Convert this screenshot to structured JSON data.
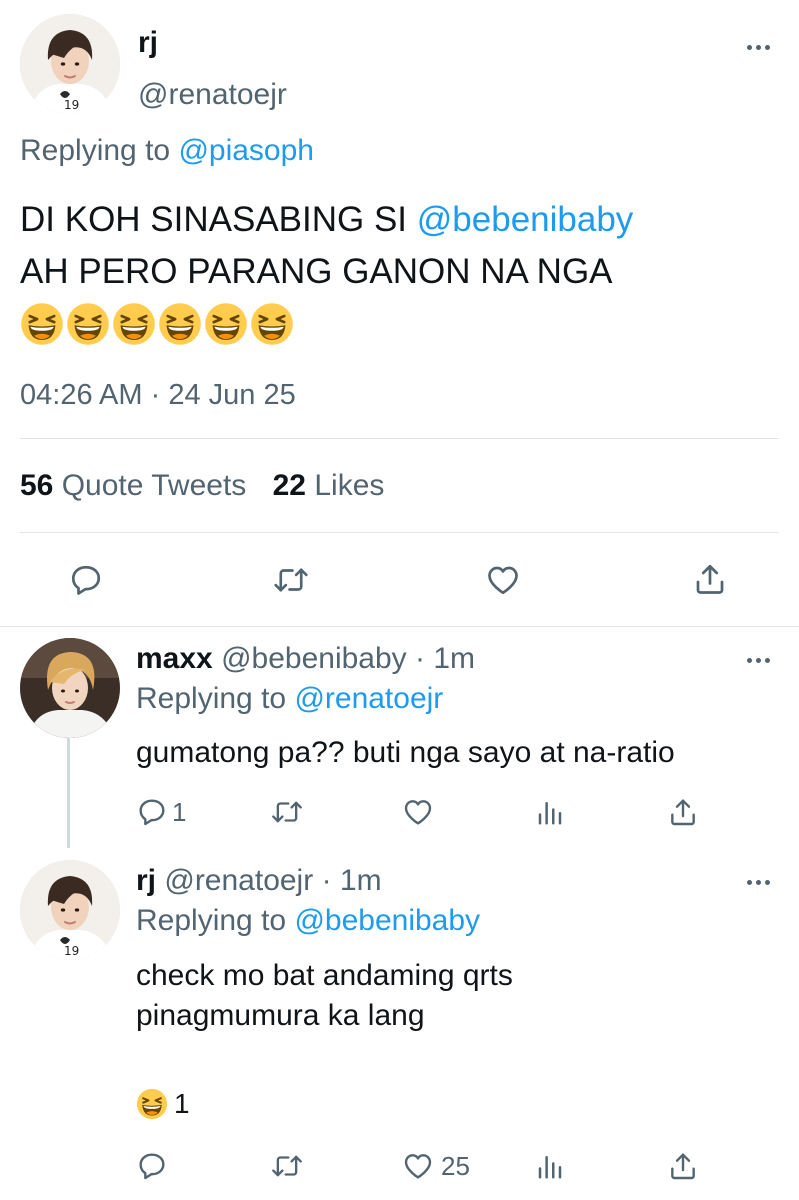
{
  "main_tweet": {
    "name": "rj",
    "handle": "@renatoejr",
    "replying_prefix": "Replying to",
    "replying_to": "@piasoph",
    "text_before": "DI KOH SINASABING SI",
    "mention": "@bebenibaby",
    "text_after": "AH PERO PARANG GANON NA NGA",
    "emoji": "grinning-squinting-face",
    "emoji_count": 6,
    "time": "04:26 AM",
    "separator": "·",
    "date": "24 Jun 25",
    "quote_count": "56",
    "quote_label": "Quote Tweets",
    "like_count": "22",
    "like_label": "Likes"
  },
  "replies": [
    {
      "name": "maxx",
      "handle": "@bebenibaby",
      "separator": "·",
      "time": "1m",
      "replying_prefix": "Replying to",
      "replying_to": "@renatoejr",
      "text_lines": [
        "gumatong pa?? buti nga sayo at na-ratio"
      ],
      "reply_count": "1",
      "like_count": ""
    },
    {
      "name": "rj",
      "handle": "@renatoejr",
      "separator": "·",
      "time": "1m",
      "replying_prefix": "Replying to",
      "replying_to": "@bebenibaby",
      "text_lines": [
        "check mo bat andaming qrts",
        "pinagmumura ka lang"
      ],
      "reaction_emoji": "grinning-squinting-face",
      "reaction_count": "1",
      "reply_count": "",
      "like_count": "25"
    }
  ],
  "colors": {
    "accent": "#1d9bf0",
    "text": "#0f1419",
    "muted": "#536471",
    "divider": "#e3e6e8",
    "emoji_face": "#ffcc4d"
  }
}
